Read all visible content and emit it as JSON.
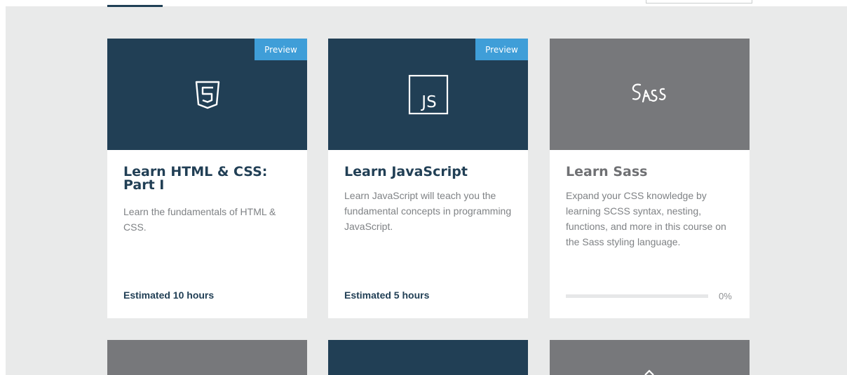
{
  "courses": [
    {
      "title": "Learn HTML & CSS: Part I",
      "description": "Learn the fundamentals of HTML & CSS.",
      "badge": "Preview",
      "estimate": "Estimated 10 hours",
      "icon": "html5-shield-icon"
    },
    {
      "title": "Learn JavaScript",
      "description": "Learn JavaScript will teach you the fundamental concepts in programming JavaScript.",
      "badge": "Preview",
      "estimate": "Estimated 5 hours",
      "icon": "javascript-logo-icon",
      "icon_text": "JS"
    },
    {
      "title": "Learn Sass",
      "description": "Expand your CSS knowledge by learning SCSS syntax, nesting, functions, and more in this course on the Sass styling language.",
      "progress_fraction": 0,
      "progress_label": "0%",
      "icon": "sass-logo-icon"
    }
  ],
  "colors": {
    "dark_card": "#213f55",
    "gray_card": "#77787b",
    "preview_badge": "#3f9ed8",
    "page_background": "#e9eaea"
  }
}
